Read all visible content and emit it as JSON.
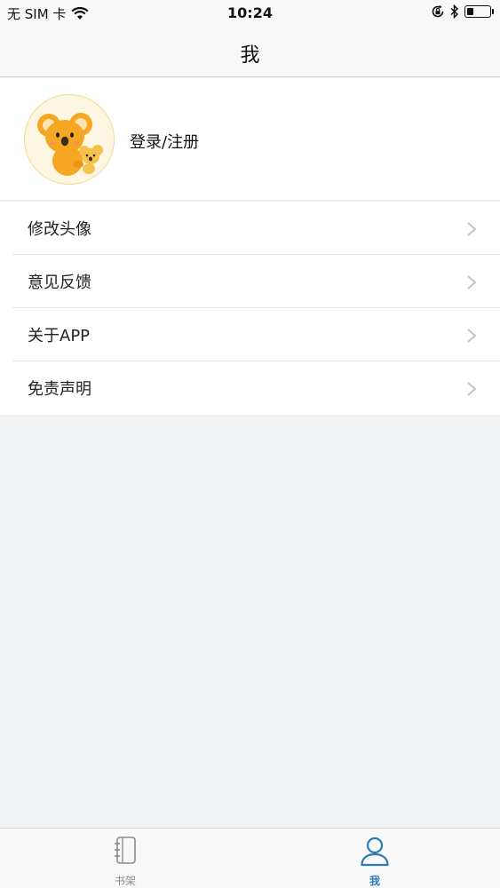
{
  "status_bar": {
    "carrier": "无 SIM 卡",
    "time": "10:24"
  },
  "nav": {
    "title": "我"
  },
  "profile": {
    "login_label": "登录/注册"
  },
  "menu": {
    "items": [
      {
        "label": "修改头像"
      },
      {
        "label": "意见反馈"
      },
      {
        "label": "关于APP"
      },
      {
        "label": "免责声明"
      }
    ]
  },
  "tab_bar": {
    "tabs": [
      {
        "label": "书架",
        "icon": "notebook-icon",
        "active": false
      },
      {
        "label": "我",
        "icon": "person-icon",
        "active": true
      }
    ]
  },
  "colors": {
    "accent": "#2b7bb6",
    "koala": "#f5a623"
  }
}
